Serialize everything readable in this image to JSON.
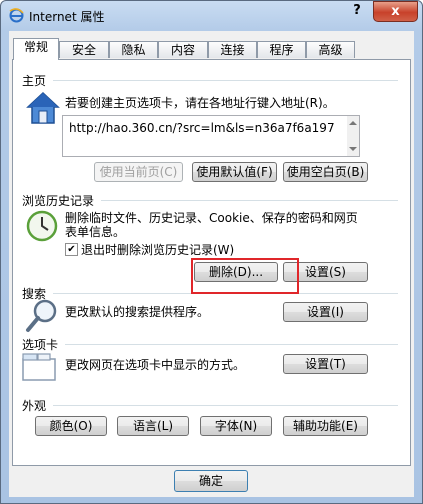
{
  "window": {
    "title": "Internet 属性",
    "help_label": "?",
    "close_label": "x"
  },
  "tabs": [
    {
      "label": "常规"
    },
    {
      "label": "安全"
    },
    {
      "label": "隐私"
    },
    {
      "label": "内容"
    },
    {
      "label": "连接"
    },
    {
      "label": "程序"
    },
    {
      "label": "高级"
    }
  ],
  "home": {
    "section_label": "主页",
    "description": "若要创建主页选项卡，请在各地址行键入地址(R)。",
    "address_value": "http://hao.360.cn/?src=lm&ls=n36a7f6a197",
    "use_current_label": "使用当前页(C)",
    "use_default_label": "使用默认值(F)",
    "use_blank_label": "使用空白页(B)"
  },
  "history": {
    "section_label": "浏览历史记录",
    "description_line1": "删除临时文件、历史记录、Cookie、保存的密码和网页",
    "description_line2": "表单信息。",
    "checkbox_label": "退出时删除浏览历史记录(W)",
    "checkbox_checked": true,
    "checkbox_mark": "✔",
    "delete_label": "删除(D)...",
    "settings_label": "设置(S)"
  },
  "search": {
    "section_label": "搜索",
    "description": "更改默认的搜索提供程序。",
    "settings_label": "设置(I)"
  },
  "tabs_section": {
    "section_label": "选项卡",
    "description": "更改网页在选项卡中显示的方式。",
    "settings_label": "设置(T)"
  },
  "appearance": {
    "section_label": "外观",
    "colors_label": "颜色(O)",
    "languages_label": "语言(L)",
    "fonts_label": "字体(N)",
    "accessibility_label": "辅助功能(E)"
  },
  "footer": {
    "ok_label": "确定"
  },
  "colors": {
    "highlight": "#e0262a",
    "title_bar": "#b3cbe8",
    "close_button": "#c8412a"
  }
}
